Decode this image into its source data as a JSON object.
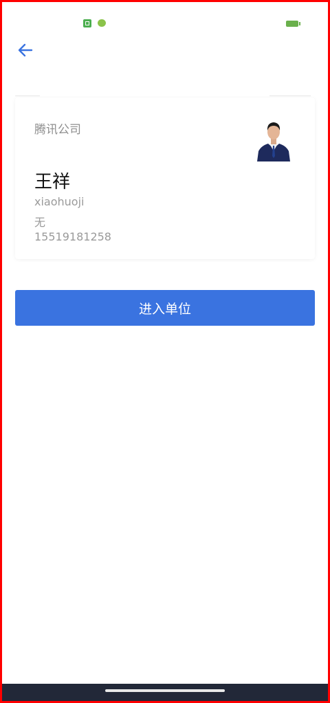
{
  "status_bar": {
    "app_icons": [
      "notification-app-icon",
      "wechat-icon"
    ],
    "battery_color": "#6ab04c"
  },
  "header": {
    "back_icon": "arrow-left-icon",
    "back_color": "#3a73e0"
  },
  "card": {
    "company": "腾讯公司",
    "name": "王祥",
    "username": "xiaohuoji",
    "department": "无",
    "phone": "15519181258",
    "avatar_icon": "user-photo"
  },
  "actions": {
    "enter_label": "进入单位",
    "enter_color": "#3a73e0"
  },
  "colors": {
    "frame": "#ff0000",
    "nav_bar": "#222838"
  }
}
